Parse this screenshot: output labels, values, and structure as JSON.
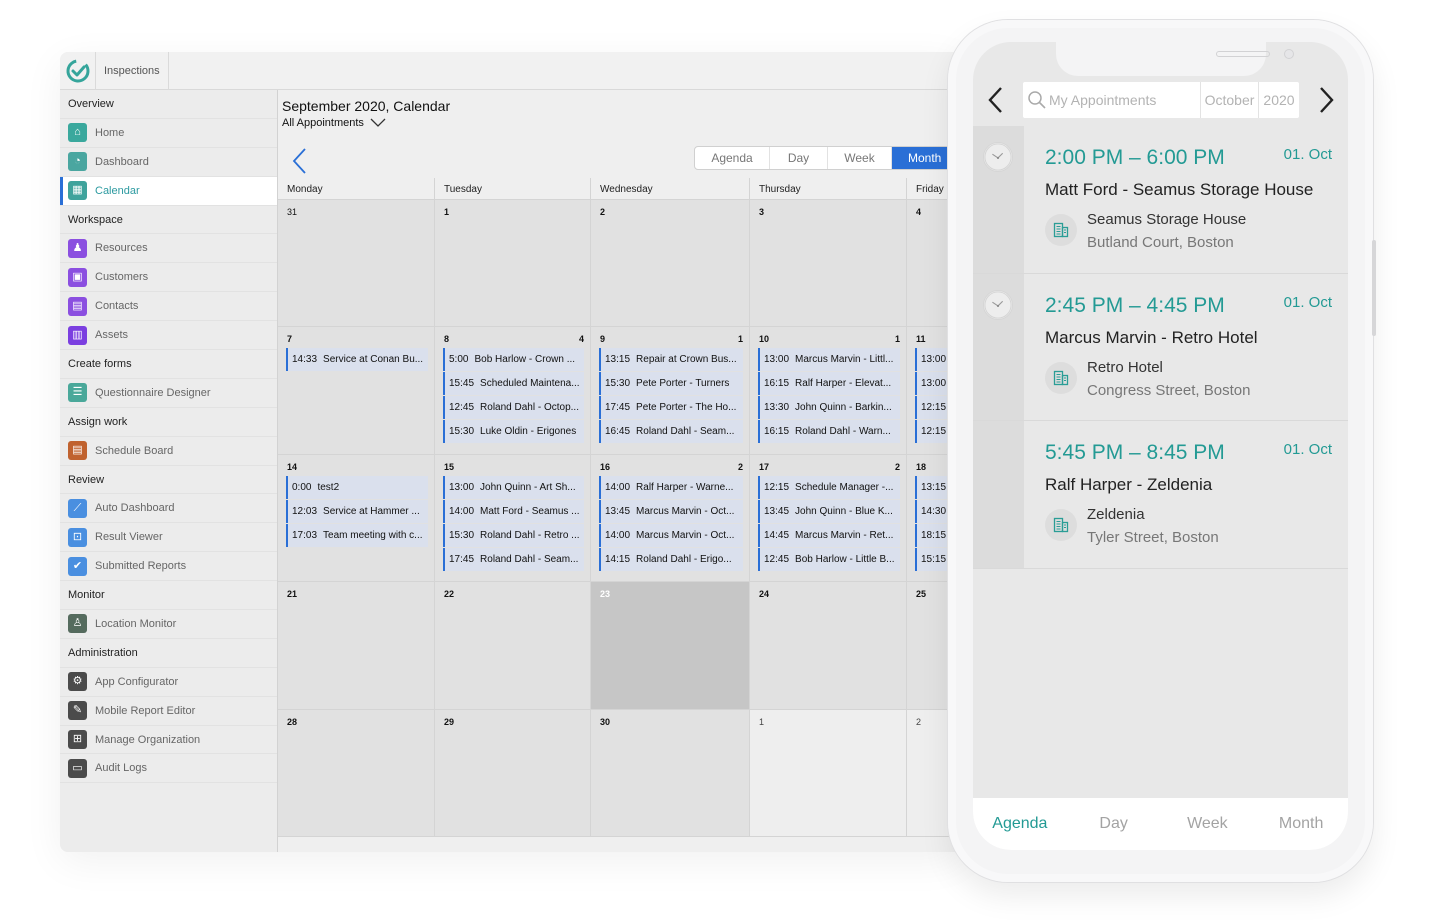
{
  "app": {
    "tab_label": "Inspections",
    "brand_color": "#2c9aa0",
    "accent_color": "#2a6fd6"
  },
  "sidebar": {
    "rows": [
      {
        "type": "section",
        "label": "Overview"
      },
      {
        "type": "item",
        "label": "Home",
        "icon": "home-icon",
        "color": "#3aa89d",
        "glyph": "⌂"
      },
      {
        "type": "item",
        "label": "Dashboard",
        "icon": "dashboard-icon",
        "color": "#4aa6a0",
        "glyph": "◔"
      },
      {
        "type": "item",
        "label": "Calendar",
        "icon": "calendar-icon",
        "color": "#3fa39c",
        "glyph": "▦",
        "active": true
      },
      {
        "type": "section",
        "label": "Workspace"
      },
      {
        "type": "item",
        "label": "Resources",
        "icon": "resources-icon",
        "color": "#8b4fe0",
        "glyph": "♟"
      },
      {
        "type": "item",
        "label": "Customers",
        "icon": "customers-icon",
        "color": "#8b4fe0",
        "glyph": "▣"
      },
      {
        "type": "item",
        "label": "Contacts",
        "icon": "contacts-icon",
        "color": "#8b4fe0",
        "glyph": "▤"
      },
      {
        "type": "item",
        "label": "Assets",
        "icon": "assets-icon",
        "color": "#7b3fe0",
        "glyph": "▥"
      },
      {
        "type": "section",
        "label": "Create forms"
      },
      {
        "type": "item",
        "label": "Questionnaire Designer",
        "icon": "questionnaire-icon",
        "color": "#4aa89a",
        "glyph": "☰"
      },
      {
        "type": "section",
        "label": "Assign work"
      },
      {
        "type": "item",
        "label": "Schedule Board",
        "icon": "schedule-board-icon",
        "color": "#c0622f",
        "glyph": "▤"
      },
      {
        "type": "section",
        "label": "Review"
      },
      {
        "type": "item",
        "label": "Auto Dashboard",
        "icon": "auto-dashboard-icon",
        "color": "#4a8fe0",
        "glyph": "⟋"
      },
      {
        "type": "item",
        "label": "Result Viewer",
        "icon": "result-viewer-icon",
        "color": "#4a8fe0",
        "glyph": "⊡"
      },
      {
        "type": "item",
        "label": "Submitted Reports",
        "icon": "submitted-reports-icon",
        "color": "#4a8fe0",
        "glyph": "✔"
      },
      {
        "type": "section",
        "label": "Monitor"
      },
      {
        "type": "item",
        "label": "Location Monitor",
        "icon": "location-monitor-icon",
        "color": "#556b5e",
        "glyph": "♙"
      },
      {
        "type": "section",
        "label": "Administration"
      },
      {
        "type": "item",
        "label": "App Configurator",
        "icon": "app-configurator-icon",
        "color": "#4b4b4b",
        "glyph": "⚙"
      },
      {
        "type": "item",
        "label": "Mobile Report Editor",
        "icon": "mobile-report-editor-icon",
        "color": "#4b4b4b",
        "glyph": "✎"
      },
      {
        "type": "item",
        "label": "Manage Organization",
        "icon": "manage-organization-icon",
        "color": "#4b4b4b",
        "glyph": "⊞"
      },
      {
        "type": "item",
        "label": "Audit Logs",
        "icon": "audit-logs-icon",
        "color": "#4b4b4b",
        "glyph": "▭"
      }
    ]
  },
  "calendar": {
    "title": "September 2020, Calendar",
    "filter_label": "All Appointments",
    "views": [
      "Agenda",
      "Day",
      "Week",
      "Month"
    ],
    "active_view": "Month",
    "weekdays": [
      "Monday",
      "Tuesday",
      "Wednesday",
      "Thursday",
      "Friday"
    ],
    "today": "23",
    "weeks": [
      [
        {
          "num": "31",
          "out": true,
          "events": []
        },
        {
          "num": "1",
          "events": []
        },
        {
          "num": "2",
          "events": []
        },
        {
          "num": "3",
          "events": []
        },
        {
          "num": "4",
          "events": []
        }
      ],
      [
        {
          "num": "7",
          "events": [
            {
              "time": "14:33",
              "title": "Service at Conan Bu..."
            }
          ]
        },
        {
          "num": "8",
          "more": "4",
          "events": [
            {
              "time": "5:00",
              "title": "Bob Harlow - Crown ..."
            },
            {
              "time": "15:45",
              "title": "Scheduled Maintena..."
            },
            {
              "time": "12:45",
              "title": "Roland Dahl - Octop..."
            },
            {
              "time": "15:30",
              "title": "Luke Oldin - Erigones"
            }
          ]
        },
        {
          "num": "9",
          "more": "1",
          "events": [
            {
              "time": "13:15",
              "title": "Repair at Crown Bus..."
            },
            {
              "time": "15:30",
              "title": "Pete Porter - Turners"
            },
            {
              "time": "17:45",
              "title": "Pete Porter - The Ho..."
            },
            {
              "time": "16:45",
              "title": "Roland Dahl - Seam..."
            }
          ]
        },
        {
          "num": "10",
          "more": "1",
          "events": [
            {
              "time": "13:00",
              "title": "Marcus Marvin - Littl..."
            },
            {
              "time": "16:15",
              "title": "Ralf Harper - Elevat..."
            },
            {
              "time": "13:30",
              "title": "John Quinn - Barkin..."
            },
            {
              "time": "16:15",
              "title": "Roland Dahl - Warn..."
            }
          ]
        },
        {
          "num": "11",
          "events": [
            {
              "time": "13:00",
              "title": ""
            },
            {
              "time": "13:00",
              "title": ""
            },
            {
              "time": "12:15",
              "title": ""
            },
            {
              "time": "12:15",
              "title": ""
            }
          ]
        }
      ],
      [
        {
          "num": "14",
          "events": [
            {
              "time": "0:00",
              "title": "test2"
            },
            {
              "time": "12:03",
              "title": "Service at Hammer ..."
            },
            {
              "time": "17:03",
              "title": "Team meeting with c..."
            }
          ]
        },
        {
          "num": "15",
          "events": [
            {
              "time": "13:00",
              "title": "John Quinn - Art Sh..."
            },
            {
              "time": "14:00",
              "title": "Matt Ford - Seamus ..."
            },
            {
              "time": "15:30",
              "title": "Roland Dahl - Retro ..."
            },
            {
              "time": "17:45",
              "title": "Roland Dahl - Seam..."
            }
          ]
        },
        {
          "num": "16",
          "more": "2",
          "events": [
            {
              "time": "14:00",
              "title": "Ralf Harper - Warne..."
            },
            {
              "time": "13:45",
              "title": "Marcus Marvin - Oct..."
            },
            {
              "time": "14:00",
              "title": "Marcus Marvin - Oct..."
            },
            {
              "time": "14:15",
              "title": "Roland Dahl - Erigo..."
            }
          ]
        },
        {
          "num": "17",
          "more": "2",
          "events": [
            {
              "time": "12:15",
              "title": "Schedule Manager -..."
            },
            {
              "time": "13:45",
              "title": "John Quinn - Blue K..."
            },
            {
              "time": "14:45",
              "title": "Marcus Marvin - Ret..."
            },
            {
              "time": "12:45",
              "title": "Bob Harlow - Little B..."
            }
          ]
        },
        {
          "num": "18",
          "events": [
            {
              "time": "13:15",
              "title": ""
            },
            {
              "time": "14:30",
              "title": ""
            },
            {
              "time": "18:15",
              "title": ""
            },
            {
              "time": "15:15",
              "title": ""
            }
          ]
        }
      ],
      [
        {
          "num": "21",
          "events": []
        },
        {
          "num": "22",
          "events": []
        },
        {
          "num": "23",
          "today": true,
          "events": []
        },
        {
          "num": "24",
          "events": []
        },
        {
          "num": "25",
          "events": []
        }
      ],
      [
        {
          "num": "28",
          "events": []
        },
        {
          "num": "29",
          "events": []
        },
        {
          "num": "30",
          "events": []
        },
        {
          "num": "1",
          "out": true,
          "events": []
        },
        {
          "num": "2",
          "out": true,
          "events": []
        }
      ]
    ]
  },
  "mobile": {
    "search_placeholder": "My Appointments",
    "month": "October",
    "year": "2020",
    "accent_color": "#239a94",
    "appointments": [
      {
        "time": "2:00 PM – 6:00 PM",
        "date": "01. Oct",
        "title": "Matt Ford - Seamus Storage House",
        "location": "Seamus Storage House",
        "address": "Butland Court, Boston"
      },
      {
        "time": "2:45 PM – 4:45 PM",
        "date": "01. Oct",
        "title": "Marcus Marvin - Retro Hotel",
        "location": "Retro Hotel",
        "address": "Congress Street, Boston"
      },
      {
        "time": "5:45 PM – 8:45 PM",
        "date": "01. Oct",
        "title": "Ralf Harper - Zeldenia",
        "location": "Zeldenia",
        "address": "Tyler Street, Boston"
      }
    ],
    "tabs": [
      "Agenda",
      "Day",
      "Week",
      "Month"
    ],
    "active_tab": "Agenda"
  }
}
